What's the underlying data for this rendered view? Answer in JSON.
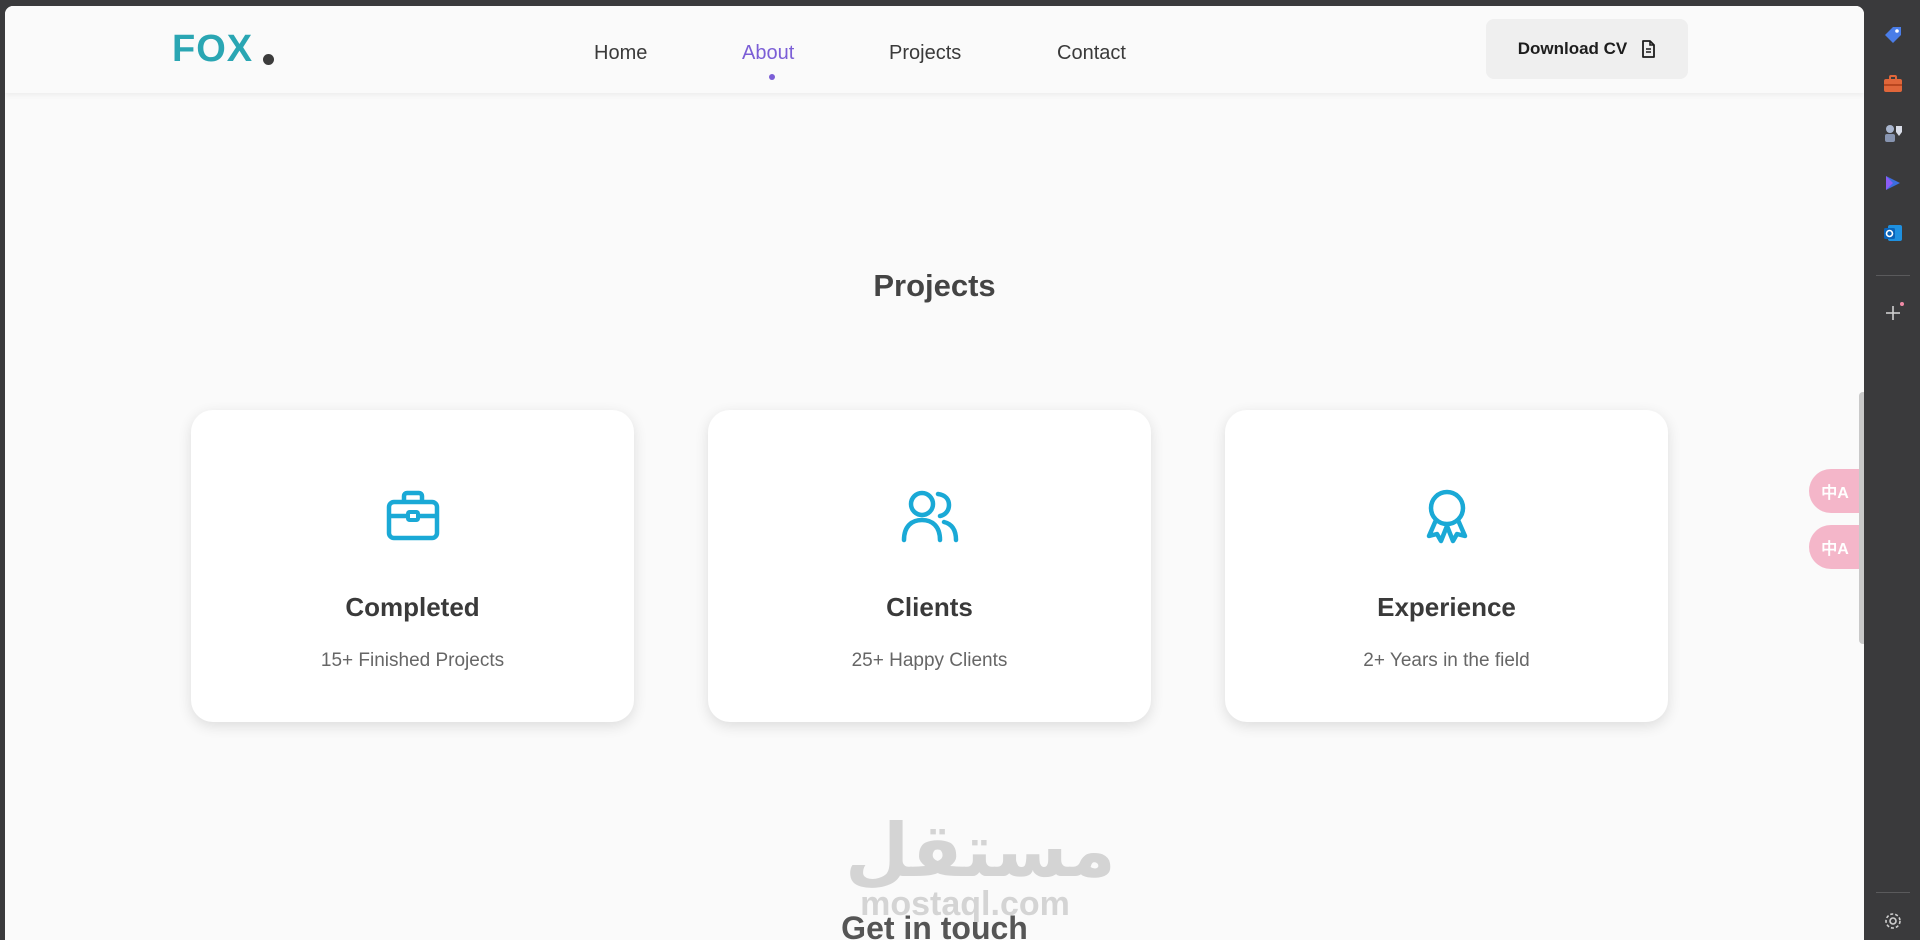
{
  "header": {
    "logo_text": "FOX",
    "nav": [
      "Home",
      "About",
      "Projects",
      "Contact"
    ],
    "active_nav": "About",
    "download_label": "Download CV"
  },
  "main": {
    "section_title": "Projects",
    "cards": [
      {
        "title": "Completed",
        "subtitle": "15+ Finished Projects",
        "icon": "briefcase-icon"
      },
      {
        "title": "Clients",
        "subtitle": "25+ Happy Clients",
        "icon": "users-icon"
      },
      {
        "title": "Experience",
        "subtitle": "2+ Years in the field",
        "icon": "award-icon"
      }
    ],
    "next_section_title": "Get in touch"
  },
  "watermark": {
    "arabic": "مستقل",
    "latin": "mostaql.com"
  },
  "floating": {
    "translate_label": "中A"
  },
  "colors": {
    "logo": "#2aa6b3",
    "active_nav": "#7b5ed6",
    "icon": "#1aa9d6",
    "translate_btn": "#f4b6c9"
  },
  "edge_sidebar_icons": [
    "tag-icon",
    "briefcase-icon",
    "games-icon",
    "copilot-icon",
    "outlook-icon",
    "add-icon",
    "settings-icon"
  ]
}
